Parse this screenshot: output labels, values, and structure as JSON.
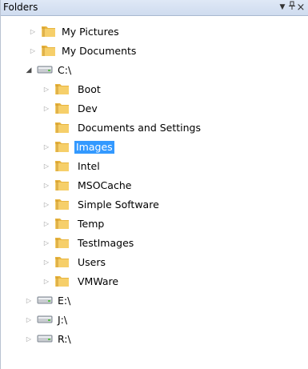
{
  "panel": {
    "title": "Folders",
    "dropdown_glyph": "▼",
    "pin_glyph": "ᵖ",
    "close_glyph": "×"
  },
  "tree": {
    "favorites": [
      {
        "label": "My Pictures",
        "icon": "folder-icon"
      },
      {
        "label": "My Documents",
        "icon": "folder-icon"
      }
    ],
    "drive_c": {
      "label": "C:\\",
      "icon": "drive-icon",
      "children": [
        {
          "label": "Boot",
          "expandable": true
        },
        {
          "label": "Dev",
          "expandable": true
        },
        {
          "label": "Documents and Settings",
          "expandable": false
        },
        {
          "label": "Images",
          "expandable": true,
          "selected": true
        },
        {
          "label": "Intel",
          "expandable": true
        },
        {
          "label": "MSOCache",
          "expandable": true
        },
        {
          "label": "Simple Software",
          "expandable": true
        },
        {
          "label": "Temp",
          "expandable": true
        },
        {
          "label": "TestImages",
          "expandable": true
        },
        {
          "label": "Users",
          "expandable": true
        },
        {
          "label": "VMWare",
          "expandable": true
        }
      ]
    },
    "other_drives": [
      {
        "label": "E:\\",
        "icon": "drive-icon"
      },
      {
        "label": "J:\\",
        "icon": "drive-icon"
      },
      {
        "label": "R:\\",
        "icon": "drive-icon"
      }
    ]
  },
  "colors": {
    "selection": "#3399ff",
    "folder": "#f4c55a"
  }
}
